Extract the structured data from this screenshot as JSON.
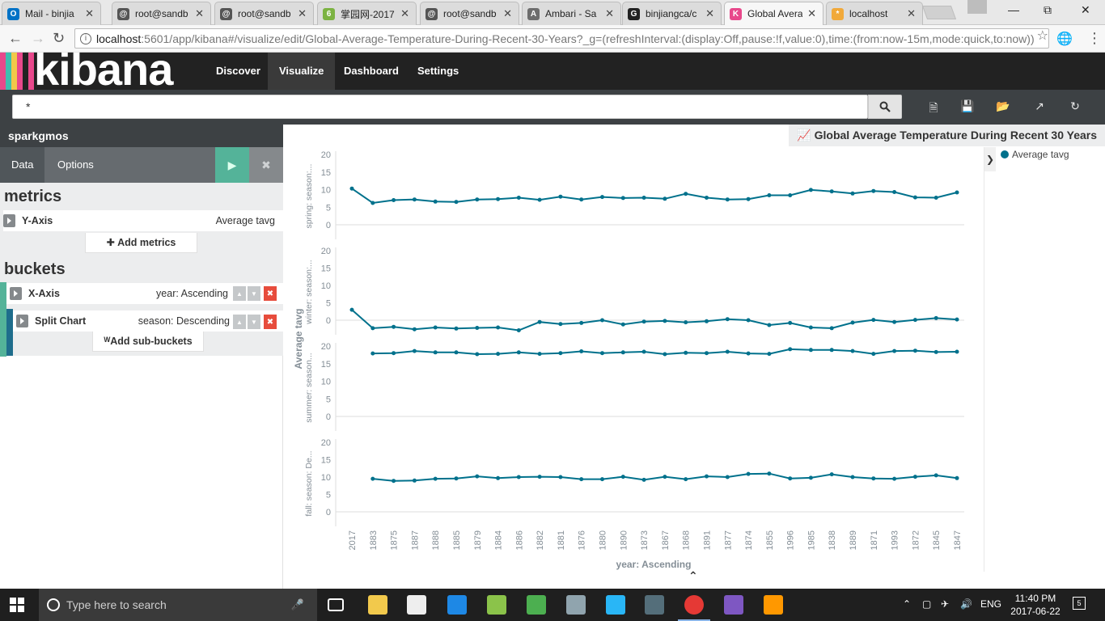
{
  "browser": {
    "tabs": [
      {
        "label": "Mail - binjia",
        "favicon": "outlook-icon",
        "color": "#0072c6",
        "glyph": "O"
      },
      {
        "label": "root@sandb",
        "favicon": "terminal-icon",
        "color": "#555555",
        "glyph": "@"
      },
      {
        "label": "root@sandb",
        "favicon": "terminal-icon",
        "color": "#555555",
        "glyph": "@"
      },
      {
        "label": "掌园网-2017",
        "favicon": "green-6-icon",
        "color": "#7cb342",
        "glyph": "6"
      },
      {
        "label": "root@sandb",
        "favicon": "terminal-icon",
        "color": "#555555",
        "glyph": "@"
      },
      {
        "label": "Ambari - Sa",
        "favicon": "ambari-icon",
        "color": "#6d6d6d",
        "glyph": "A"
      },
      {
        "label": "binjiangca/c",
        "favicon": "github-icon",
        "color": "#222222",
        "glyph": "G"
      },
      {
        "label": "Global Avera",
        "favicon": "kibana-icon",
        "color": "#e8488b",
        "glyph": "K"
      },
      {
        "label": "localhost",
        "favicon": "kibana-flower-icon",
        "color": "#f1a93a",
        "glyph": "*"
      }
    ],
    "url_host": "localhost",
    "url_path": ":5601/app/kibana#/visualize/edit/Global-Average-Temperature-During-Recent-30-Years?_g=(refreshInterval:(display:Off,pause:!f,value:0),time:(from:now-15m,mode:quick,to:now))"
  },
  "kibana": {
    "logo": "kibana",
    "nav": [
      "Discover",
      "Visualize",
      "Dashboard",
      "Settings"
    ],
    "active_nav": "Visualize",
    "query": "*"
  },
  "sidebar": {
    "index": "sparkgmos",
    "tabs": [
      "Data",
      "Options"
    ],
    "metrics_header": "metrics",
    "y_axis_label": "Y-Axis",
    "y_axis_value": "Average tavg",
    "add_metrics": "Add metrics",
    "buckets_header": "buckets",
    "x_axis_label": "X-Axis",
    "x_axis_value": "year: Ascending",
    "split_label": "Split Chart",
    "split_value": "season: Descending",
    "add_sub_buckets": "Add sub-buckets"
  },
  "vis": {
    "title": "Global Average Temperature During Recent 30 Years",
    "legend": "Average tavg",
    "series_color": "#00718c"
  },
  "chart_data": {
    "type": "line",
    "title": "Global Average Temperature During Recent 30 Years",
    "xlabel": "year: Ascending",
    "ylabel": "Average tavg",
    "ylim": [
      0,
      20
    ],
    "yticks": [
      0,
      5,
      10,
      15,
      20
    ],
    "legend": "top-right",
    "categories": [
      "2017",
      "1883",
      "1875",
      "1887",
      "1888",
      "1885",
      "1879",
      "1884",
      "1886",
      "1882",
      "1881",
      "1876",
      "1880",
      "1890",
      "1873",
      "1867",
      "1868",
      "1891",
      "1877",
      "1874",
      "1855",
      "1996",
      "1985",
      "1838",
      "1889",
      "1871",
      "1993",
      "1872",
      "1845",
      "1847"
    ],
    "series": [
      {
        "name": "spring: season:...",
        "panel_label": "spring: season:...",
        "values": [
          10.3,
          6.2,
          7.0,
          7.2,
          6.6,
          6.5,
          7.2,
          7.3,
          7.7,
          7.1,
          8.0,
          7.2,
          7.9,
          7.6,
          7.7,
          7.4,
          8.8,
          7.7,
          7.2,
          7.3,
          8.4,
          8.4,
          9.9,
          9.5,
          8.9,
          9.6,
          9.3,
          7.8,
          7.7,
          9.2
        ]
      },
      {
        "name": "winter: season:...",
        "panel_label": "winter: season:...",
        "values": [
          3.0,
          -2.3,
          -1.9,
          -2.6,
          -2.1,
          -2.4,
          -2.2,
          -2.1,
          -2.9,
          -0.5,
          -1.1,
          -0.8,
          0.0,
          -1.2,
          -0.4,
          -0.2,
          -0.6,
          -0.3,
          0.3,
          0.0,
          -1.4,
          -0.8,
          -2.1,
          -2.3,
          -0.7,
          0.1,
          -0.5,
          0.1,
          0.6,
          0.2
        ]
      },
      {
        "name": "summer: season:...",
        "panel_label": "summer: season...",
        "values": [
          null,
          17.9,
          18.0,
          18.6,
          18.2,
          18.2,
          17.7,
          17.8,
          18.2,
          17.8,
          18.0,
          18.5,
          18.0,
          18.2,
          18.4,
          17.7,
          18.1,
          18.0,
          18.4,
          17.9,
          17.8,
          19.1,
          18.9,
          18.9,
          18.6,
          17.8,
          18.6,
          18.7,
          18.3,
          18.4
        ]
      },
      {
        "name": "fall: season: De...",
        "panel_label": "fall: season: De...",
        "values": [
          null,
          9.5,
          8.9,
          9.0,
          9.5,
          9.6,
          10.2,
          9.7,
          10.0,
          10.1,
          10.0,
          9.4,
          9.4,
          10.1,
          9.2,
          10.1,
          9.4,
          10.2,
          10.0,
          10.9,
          11.0,
          9.6,
          9.8,
          10.8,
          10.0,
          9.6,
          9.5,
          10.1,
          10.5,
          9.7
        ]
      }
    ]
  },
  "taskbar": {
    "search_placeholder": "Type here to search",
    "lang": "ENG",
    "time": "11:40 PM",
    "date": "2017-06-22",
    "notifications": "5"
  }
}
